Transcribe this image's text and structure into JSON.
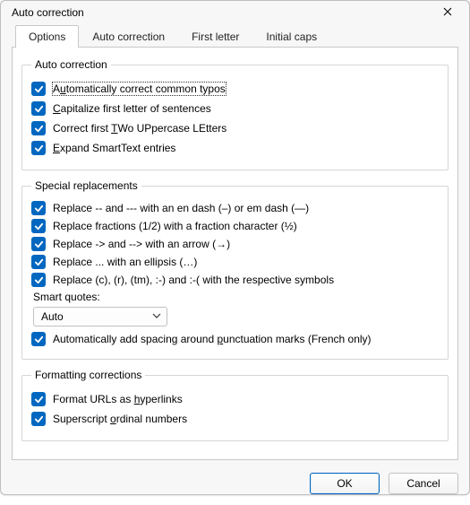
{
  "window": {
    "title": "Auto correction"
  },
  "tabs": {
    "options": "Options",
    "auto": "Auto correction",
    "first": "First letter",
    "caps": "Initial caps"
  },
  "groups": {
    "auto": {
      "legend": "Auto correction",
      "typos": {
        "pre": "A",
        "ul": "u",
        "post": "tomatically correct common typos"
      },
      "cap": {
        "ul": "C",
        "post": "apitalize first letter of sentences"
      },
      "two": {
        "pre": "Correct first ",
        "ul": "T",
        "post": "Wo UPpercase LEtters"
      },
      "smart": {
        "ul": "E",
        "post": "xpand SmartText entries"
      }
    },
    "special": {
      "legend": "Special replacements",
      "dash": "Replace -- and --- with an en dash (–) or em dash (—)",
      "frac": "Replace fractions (1/2) with a fraction character (½)",
      "arrow": "Replace -> and --> with an arrow (→)",
      "ellip": "Replace ... with an ellipsis (…)",
      "syms": "Replace (c), (r), (tm), :-) and :-( with the respective symbols",
      "quotes_label": {
        "pre": "Smart ",
        "ul": "q",
        "post": "uotes:"
      },
      "quotes_value": "Auto",
      "french": {
        "pre": "Automatically add spacing around ",
        "ul": "p",
        "post": "unctuation marks (French only)"
      }
    },
    "format": {
      "legend": "Formatting corrections",
      "urls": {
        "pre": "Format URLs as ",
        "ul": "h",
        "post": "yperlinks"
      },
      "ord": {
        "pre": "Superscript ",
        "ul": "o",
        "post": "rdinal numbers"
      }
    }
  },
  "buttons": {
    "ok": "OK",
    "cancel": "Cancel"
  }
}
